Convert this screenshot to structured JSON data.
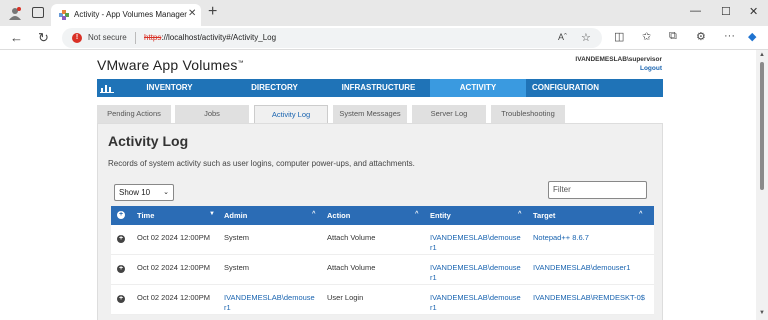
{
  "browser": {
    "tab_title": "Activity - App Volumes Manager",
    "new_tab": "+",
    "not_secure": "Not secure",
    "url_scheme": "https",
    "url_rest": "://localhost/activity#/Activity_Log",
    "minimize": "—",
    "maximize": "☐",
    "close": "✕"
  },
  "app": {
    "brand": "VMware App Volumes",
    "brand_tm": "™",
    "user": "IVANDEMESLAB\\supervisor",
    "logout": "Logout"
  },
  "mainnav": [
    "INVENTORY",
    "DIRECTORY",
    "INFRASTRUCTURE",
    "ACTIVITY",
    "CONFIGURATION"
  ],
  "subtabs": [
    "Pending Actions",
    "Jobs",
    "Activity Log",
    "System Messages",
    "Server Log",
    "Troubleshooting"
  ],
  "panel": {
    "title": "Activity Log",
    "description": "Records of system activity such as user logins, computer power-ups, and attachments.",
    "show": "Show 10",
    "filter_placeholder": "Filter"
  },
  "table": {
    "columns": [
      "Time",
      "Admin",
      "Action",
      "Entity",
      "Target"
    ],
    "rows": [
      {
        "time": "Oct 02 2024 12:00PM",
        "admin": "System",
        "action": "Attach Volume",
        "entity1": "IVANDEMESLAB\\demouse",
        "entity2": "r1",
        "target": "Notepad++ 8.6.7"
      },
      {
        "time": "Oct 02 2024 12:00PM",
        "admin": "System",
        "action": "Attach Volume",
        "entity1": "IVANDEMESLAB\\demouse",
        "entity2": "r1",
        "target": "IVANDEMESLAB\\demouser1"
      },
      {
        "time": "Oct 02 2024 12:00PM",
        "admin1": "IVANDEMESLAB\\demouse",
        "admin2": "r1",
        "action": "User Login",
        "entity1": "IVANDEMESLAB\\demouse",
        "entity2": "r1",
        "target": "IVANDEMESLAB\\REMDESKT-0$"
      }
    ]
  },
  "colors": {
    "nav": "#1f73b7",
    "nav_active": "#3a9ae0",
    "header": "#2b6cb5",
    "link": "#1a64b0"
  }
}
